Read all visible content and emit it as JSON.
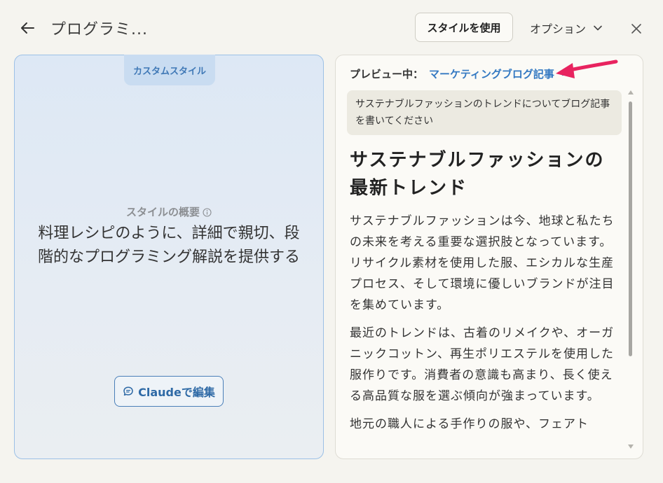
{
  "header": {
    "title": "プログラミ...",
    "use_style_label": "スタイルを使用",
    "options_label": "オプション"
  },
  "left_panel": {
    "tab_label": "カスタムスタイル",
    "overview_label": "スタイルの概要",
    "overview_text": "料理レシピのように、詳細で親切、段階的なプログラミング解説を提供する",
    "edit_button_label": "Claudeで編集"
  },
  "preview": {
    "label": "プレビュー中：",
    "selected": "マーケティングブログ記事",
    "prompt": "サステナブルファッションのトレンドについてブログ記事を書いてください",
    "article_title": "サステナブルファッションの最新トレンド",
    "paragraphs": [
      "サステナブルファッションは今、地球と私たちの未来を考える重要な選択肢となっています。リサイクル素材を使用した服、エシカルな生産プロセス、そして環境に優しいブランドが注目を集めています。",
      "最近のトレンドは、古着のリメイクや、オーガニックコットン、再生ポリエステルを使用した服作りです。消費者の意識も高まり、長く使える高品質な服を選ぶ傾向が強まっています。",
      "地元の職人による手作りの服や、フェアト"
    ]
  },
  "icons": {
    "back": "arrow-left-icon",
    "close": "close-icon",
    "options_chevron": "chevron-down-icon",
    "select_chevron": "chevron-down-icon",
    "info": "info-icon",
    "edit": "chat-bubble-icon",
    "annotation_arrow": "pink-arrow-icon"
  },
  "colors": {
    "accent_blue": "#3479c2",
    "annotation_pink": "#e8235f",
    "left_card_border": "#9cc0e6",
    "background": "#f5f4ef"
  }
}
